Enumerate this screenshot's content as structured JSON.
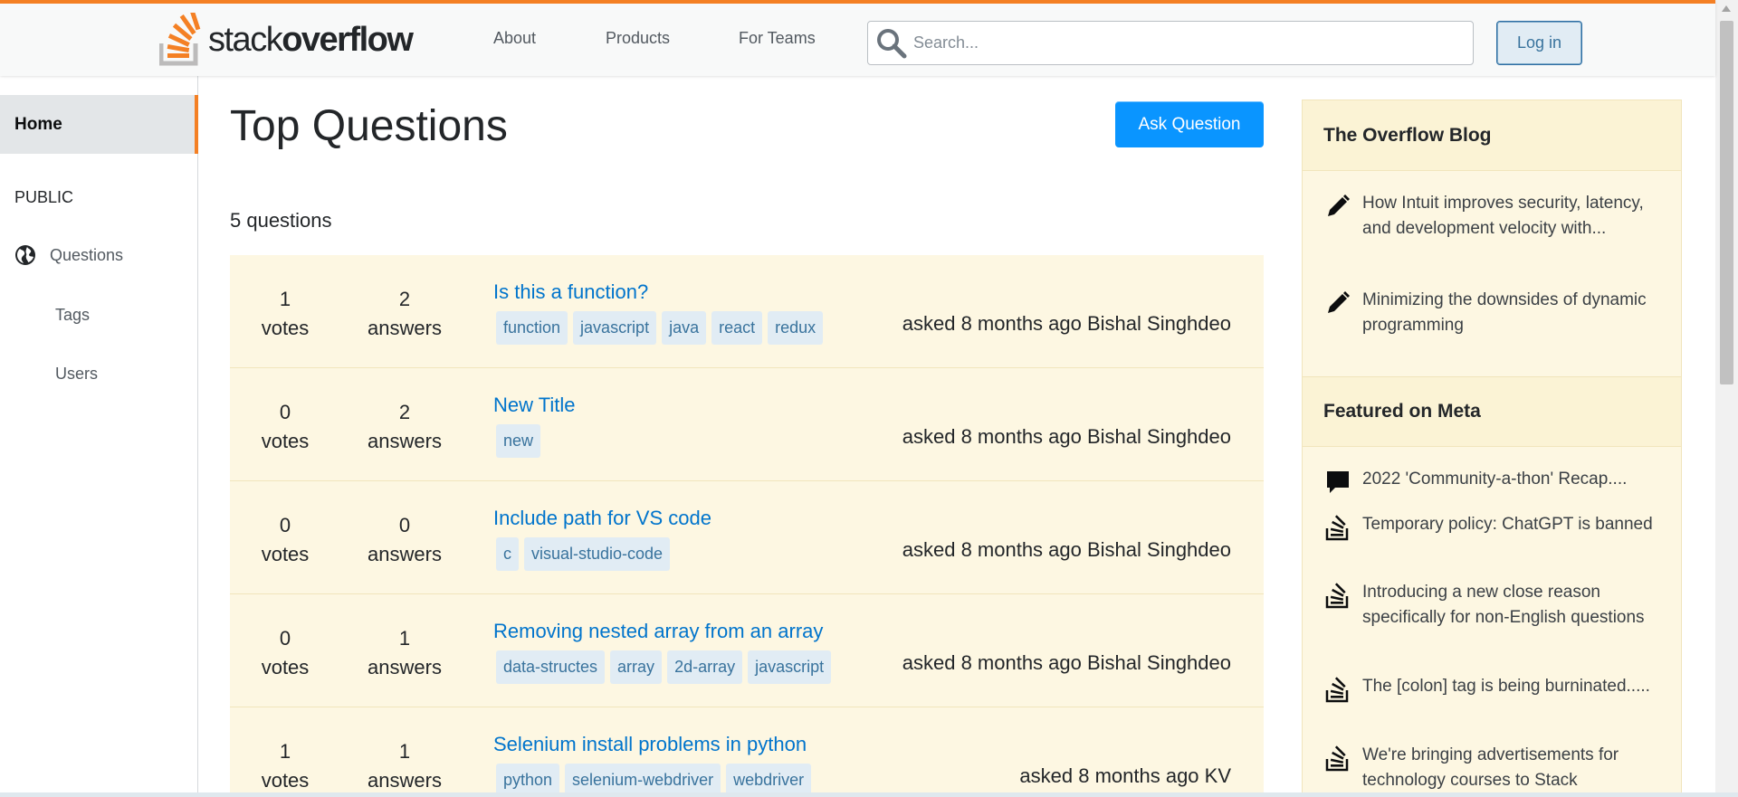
{
  "colors": {
    "brand": "#f48024",
    "link": "#0074cc",
    "primary_button": "#0a95ff",
    "row_bg": "#fdf7e2",
    "tag_bg": "#e1ecf4"
  },
  "header": {
    "logo": {
      "light": "stack",
      "bold": "overflow"
    },
    "nav": [
      "About",
      "Products",
      "For Teams"
    ],
    "search_placeholder": "Search...",
    "login_label": "Log in"
  },
  "sidebar": {
    "home": "Home",
    "section": "PUBLIC",
    "questions": "Questions",
    "tags": "Tags",
    "users": "Users"
  },
  "main": {
    "title": "Top Questions",
    "ask_label": "Ask Question",
    "count": "5 questions",
    "questions": [
      {
        "votes": "1",
        "votes_label": "votes",
        "answers": "2",
        "answers_label": "answers",
        "title": "Is this a function?",
        "tags": [
          "function",
          "javascript",
          "java",
          "react",
          "redux"
        ],
        "asked": "asked 8 months ago Bishal Singhdeo"
      },
      {
        "votes": "0",
        "votes_label": "votes",
        "answers": "2",
        "answers_label": "answers",
        "title": "New Title",
        "tags": [
          "new"
        ],
        "asked": "asked 8 months ago Bishal Singhdeo"
      },
      {
        "votes": "0",
        "votes_label": "votes",
        "answers": "0",
        "answers_label": "answers",
        "title": "Include path for VS code",
        "tags": [
          "c",
          "visual-studio-code"
        ],
        "asked": "asked 8 months ago Bishal Singhdeo"
      },
      {
        "votes": "0",
        "votes_label": "votes",
        "answers": "1",
        "answers_label": "answers",
        "title": "Removing nested array from an array",
        "tags": [
          "data-structes",
          "array",
          "2d-array",
          "javascript"
        ],
        "asked": "asked 8 months ago Bishal Singhdeo"
      },
      {
        "votes": "1",
        "votes_label": "votes",
        "answers": "1",
        "answers_label": "answers",
        "title": "Selenium install problems in python",
        "tags": [
          "python",
          "selenium-webdriver",
          "webdriver"
        ],
        "asked": "asked 8 months ago KV"
      }
    ]
  },
  "right": {
    "blog_title": "The Overflow Blog",
    "blog_items": [
      {
        "icon": "pencil-icon",
        "text": "How Intuit improves security, latency, and development velocity with..."
      },
      {
        "icon": "pencil-icon",
        "text": "Minimizing the downsides of dynamic programming"
      }
    ],
    "meta_title": "Featured on Meta",
    "meta_items": [
      {
        "icon": "chat-bubble-icon",
        "text": "2022 'Community-a-thon' Recap...."
      },
      {
        "icon": "stackoverflow-icon",
        "text": "Temporary policy: ChatGPT is banned"
      },
      {
        "icon": "stackoverflow-icon",
        "text": "Introducing a new close reason specifically for non-English questions"
      },
      {
        "icon": "stackoverflow-icon",
        "text": "The [colon] tag is being burninated....."
      },
      {
        "icon": "stackoverflow-icon",
        "text": "We're bringing advertisements for technology courses to Stack"
      }
    ]
  }
}
